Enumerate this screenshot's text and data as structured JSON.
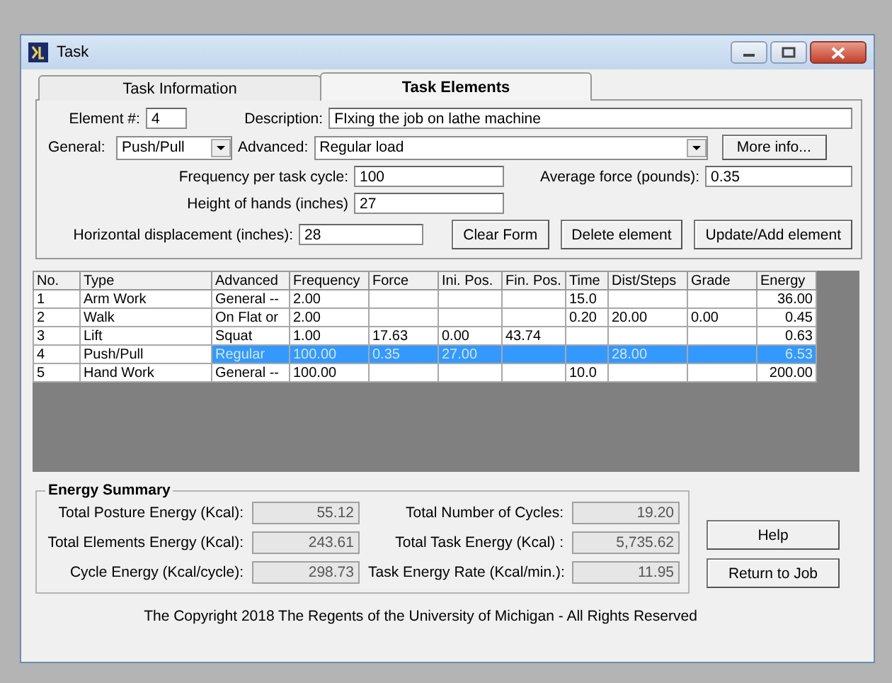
{
  "window": {
    "title": "Task"
  },
  "tabs": [
    {
      "label": "Task Information",
      "selected": false
    },
    {
      "label": "Task Elements",
      "selected": true
    }
  ],
  "form": {
    "element": {
      "label": "Element #:",
      "value": "4"
    },
    "description": {
      "label": "Description:",
      "value": "FIxing the job on lathe machine"
    },
    "general": {
      "label": "General:",
      "value": "Push/Pull"
    },
    "advanced": {
      "label": "Advanced:",
      "value": "Regular load"
    },
    "more_info": "More info...",
    "frequency": {
      "label": "Frequency per task cycle:",
      "value": "100"
    },
    "average_force": {
      "label": "Average force (pounds):",
      "value": "0.35"
    },
    "height": {
      "label": "Height of hands (inches)",
      "value": "27"
    },
    "horizontal": {
      "label": "Horizontal displacement (inches):",
      "value": "28"
    },
    "buttons": [
      "Clear Form",
      "Delete element",
      "Update/Add element"
    ]
  },
  "table": {
    "columns": [
      "No.",
      "Type",
      "Advanced",
      "Frequency",
      "Force",
      "Ini. Pos.",
      "Fin. Pos.",
      "Time",
      "Dist/Steps",
      "Grade",
      "Energy"
    ],
    "rows": [
      {
        "selected": false,
        "cells": [
          "1",
          "Arm Work",
          "General --",
          "2.00",
          "",
          "",
          "",
          "15.0",
          "",
          "",
          "36.00"
        ]
      },
      {
        "selected": false,
        "cells": [
          "2",
          "Walk",
          "On Flat or",
          "2.00",
          "",
          "",
          "",
          "0.20",
          "20.00",
          "0.00",
          "0.45"
        ]
      },
      {
        "selected": false,
        "cells": [
          "3",
          "Lift",
          "Squat",
          "1.00",
          "17.63",
          "0.00",
          "43.74",
          "",
          "",
          "",
          "0.63"
        ]
      },
      {
        "selected": true,
        "cells": [
          "4",
          "Push/Pull",
          "Regular",
          "100.00",
          "0.35",
          "27.00",
          "",
          "",
          "28.00",
          "",
          "6.53"
        ]
      },
      {
        "selected": false,
        "cells": [
          "5",
          "Hand Work",
          "General --",
          "100.00",
          "",
          "",
          "",
          "10.0",
          "",
          "",
          "200.00"
        ]
      }
    ]
  },
  "energy_summary": {
    "title": "Energy Summary",
    "items": [
      {
        "label": "Total Posture Energy (Kcal):",
        "value": "55.12"
      },
      {
        "label": "Total Number of Cycles:",
        "value": "19.20"
      },
      {
        "label": "Total Elements Energy (Kcal):",
        "value": "243.61"
      },
      {
        "label": "Total Task Energy (Kcal) :",
        "value": "5,735.62"
      },
      {
        "label": "Cycle Energy (Kcal/cycle):",
        "value": "298.73"
      },
      {
        "label": "Task Energy Rate (Kcal/min.):",
        "value": "11.95"
      }
    ]
  },
  "side_buttons": [
    "Help",
    "Return to Job"
  ],
  "copyright": "The Copyright 2018 The Regents of the University of Michigan  - All Rights Reserved"
}
